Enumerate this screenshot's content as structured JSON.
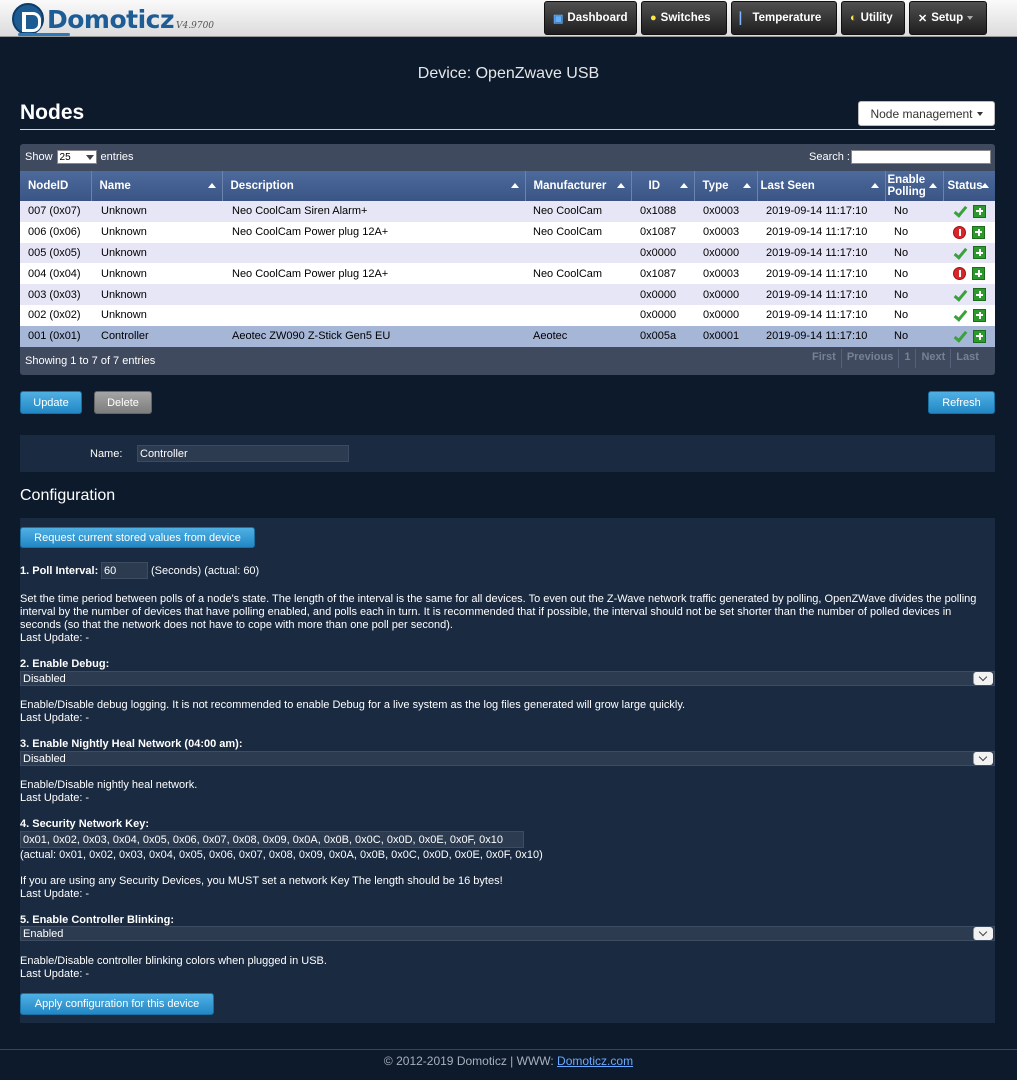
{
  "app": {
    "logo_text": "Domoticz",
    "version": "V4.9700"
  },
  "nav": [
    {
      "label": "Dashboard",
      "icon": "dashboard-icon"
    },
    {
      "label": "Switches",
      "icon": "lightbulb-icon"
    },
    {
      "label": "Temperature",
      "icon": "thermometer-icon"
    },
    {
      "label": "Utility",
      "icon": "utility-icon"
    },
    {
      "label": "Setup",
      "icon": "tools-icon"
    }
  ],
  "page": {
    "device_title": "Device: OpenZwave USB",
    "nodes_title": "Nodes",
    "node_management": "Node management"
  },
  "table": {
    "show_label": "Show",
    "entries_label": "entries",
    "page_size": "25",
    "search_label": "Search :",
    "search_value": "",
    "columns": [
      "NodeID",
      "Name",
      "Description",
      "Manufacturer",
      "ID",
      "Type",
      "Last Seen",
      "Enable Polling",
      "Status"
    ],
    "rows": [
      {
        "nodeid": "007 (0x07)",
        "name": "Unknown",
        "description": "Neo CoolCam Siren Alarm+",
        "manufacturer": "Neo CoolCam",
        "id": "0x1088",
        "type": "0x0003",
        "last_seen": "2019-09-14 11:17:10",
        "polling": "No",
        "status": "ok"
      },
      {
        "nodeid": "006 (0x06)",
        "name": "Unknown",
        "description": "Neo CoolCam Power plug 12A+",
        "manufacturer": "Neo CoolCam",
        "id": "0x1087",
        "type": "0x0003",
        "last_seen": "2019-09-14 11:17:10",
        "polling": "No",
        "status": "error"
      },
      {
        "nodeid": "005 (0x05)",
        "name": "Unknown",
        "description": "",
        "manufacturer": "",
        "id": "0x0000",
        "type": "0x0000",
        "last_seen": "2019-09-14 11:17:10",
        "polling": "No",
        "status": "ok"
      },
      {
        "nodeid": "004 (0x04)",
        "name": "Unknown",
        "description": "Neo CoolCam Power plug 12A+",
        "manufacturer": "Neo CoolCam",
        "id": "0x1087",
        "type": "0x0003",
        "last_seen": "2019-09-14 11:17:10",
        "polling": "No",
        "status": "error"
      },
      {
        "nodeid": "003 (0x03)",
        "name": "Unknown",
        "description": "",
        "manufacturer": "",
        "id": "0x0000",
        "type": "0x0000",
        "last_seen": "2019-09-14 11:17:10",
        "polling": "No",
        "status": "ok"
      },
      {
        "nodeid": "002 (0x02)",
        "name": "Unknown",
        "description": "",
        "manufacturer": "",
        "id": "0x0000",
        "type": "0x0000",
        "last_seen": "2019-09-14 11:17:10",
        "polling": "No",
        "status": "ok"
      },
      {
        "nodeid": "001 (0x01)",
        "name": "Controller",
        "description": "Aeotec ZW090 Z-Stick Gen5 EU",
        "manufacturer": "Aeotec",
        "id": "0x005a",
        "type": "0x0001",
        "last_seen": "2019-09-14 11:17:10",
        "polling": "No",
        "status": "ok"
      }
    ],
    "info": "Showing 1 to 7 of 7 entries",
    "pager": [
      "First",
      "Previous",
      "1",
      "Next",
      "Last"
    ]
  },
  "buttons": {
    "update": "Update",
    "delete": "Delete",
    "refresh": "Refresh",
    "request_values": "Request current stored values from device",
    "apply_config": "Apply configuration for this device"
  },
  "name_field": {
    "label": "Name:",
    "value": "Controller"
  },
  "config": {
    "title": "Configuration",
    "poll": {
      "label": "1. Poll Interval:",
      "value": "60",
      "suffix": "(Seconds) (actual: 60)",
      "desc": "Set the time period between polls of a node's state. The length of the interval is the same for all devices. To even out the Z-Wave network traffic generated by polling, OpenZWave divides the polling interval by the number of devices that have polling enabled, and polls each in turn. It is recommended that if possible, the interval should not be set shorter than the number of polled devices in seconds (so that the network does not have to cope with more than one poll per second).",
      "last_update": "Last Update: -"
    },
    "debug": {
      "label": "2. Enable Debug:",
      "value": "Disabled",
      "desc": "Enable/Disable debug logging. It is not recommended to enable Debug for a live system as the log files generated will grow large quickly.",
      "last_update": "Last Update: -"
    },
    "heal": {
      "label": "3. Enable Nightly Heal Network (04:00 am):",
      "value": "Disabled",
      "desc": "Enable/Disable nightly heal network.",
      "last_update": "Last Update: -"
    },
    "security": {
      "label": "4. Security Network Key:",
      "value": "0x01, 0x02, 0x03, 0x04, 0x05, 0x06, 0x07, 0x08, 0x09, 0x0A, 0x0B, 0x0C, 0x0D, 0x0E, 0x0F, 0x10",
      "actual": "(actual: 0x01, 0x02, 0x03, 0x04, 0x05, 0x06, 0x07, 0x08, 0x09, 0x0A, 0x0B, 0x0C, 0x0D, 0x0E, 0x0F, 0x10)",
      "desc": "If you are using any Security Devices, you MUST set a network Key The length should be 16 bytes!",
      "last_update": "Last Update: -"
    },
    "blinking": {
      "label": "5. Enable Controller Blinking:",
      "value": "Enabled",
      "desc": "Enable/Disable controller blinking colors when plugged in USB.",
      "last_update": "Last Update: -"
    }
  },
  "footer": {
    "text": "© 2012-2019 Domoticz | WWW: ",
    "link": "Domoticz.com"
  }
}
